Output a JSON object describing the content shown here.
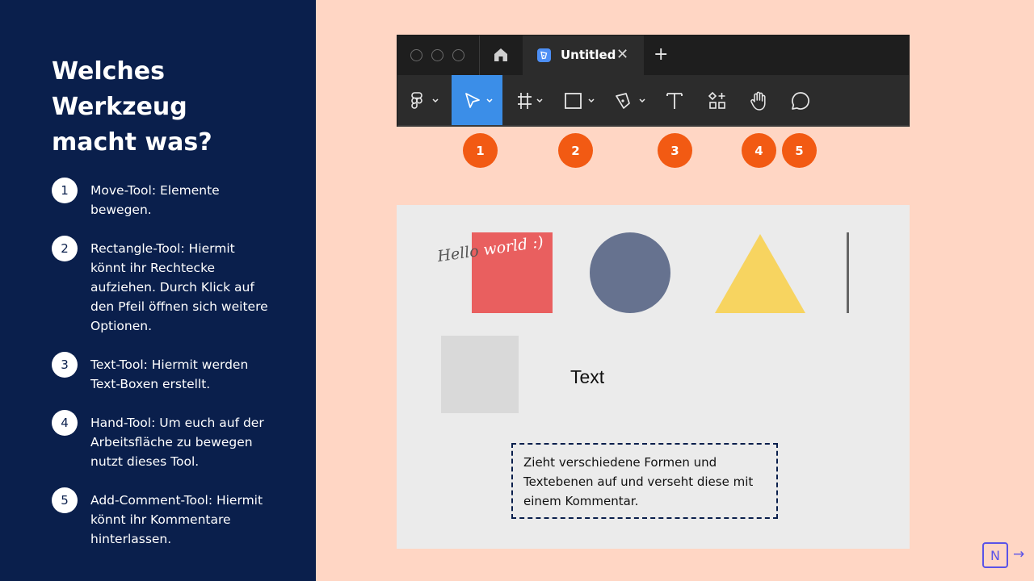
{
  "heading": {
    "line1": "Welches",
    "line2": "Werkzeug",
    "line3": "macht was?"
  },
  "steps": [
    {
      "num": "1",
      "text": "Move-Tool: Elemente\nbewegen."
    },
    {
      "num": "2",
      "text": "Rectangle-Tool: Hiermit\nkönnt ihr Rechtecke\naufziehen. Durch Klick auf\nden Pfeil öffnen sich weitere\nOptionen."
    },
    {
      "num": "3",
      "text": "Text-Tool: Hiermit werden\nText-Boxen erstellt."
    },
    {
      "num": "4",
      "text": "Hand-Tool: Um euch auf der\nArbeitsfläche zu bewegen\nnutzt dieses Tool."
    },
    {
      "num": "5",
      "text": "Add-Comment-Tool: Hiermit\nkönnt ihr Kommentare\nhinterlassen."
    }
  ],
  "window": {
    "tab_title": "Untitled",
    "tab_close": "✕",
    "new_tab": "+"
  },
  "toolbar": {
    "tools": [
      "figma-menu-icon",
      "move-icon",
      "frame-icon",
      "rectangle-icon",
      "pen-icon",
      "text-icon",
      "components-icon",
      "hand-icon",
      "comment-icon"
    ],
    "active_tool": "move",
    "active_color": "#3b8ee8"
  },
  "badges": [
    "1",
    "2",
    "3",
    "4",
    "5"
  ],
  "canvas": {
    "hello_part1": "Hello ",
    "hello_part2": "world :)",
    "text_label": "Text",
    "note": "Zieht verschiedene Formen und Textebenen auf und verseht diese mit einem Kommentar."
  },
  "colors": {
    "navy": "#0a1f4c",
    "peach": "#ffd6c4",
    "badge": "#f25a13",
    "red_square": "#e95f5f",
    "circle": "#66728f",
    "triangle": "#f7d460"
  },
  "logo": {
    "letter": "N",
    "arrow": "→"
  }
}
